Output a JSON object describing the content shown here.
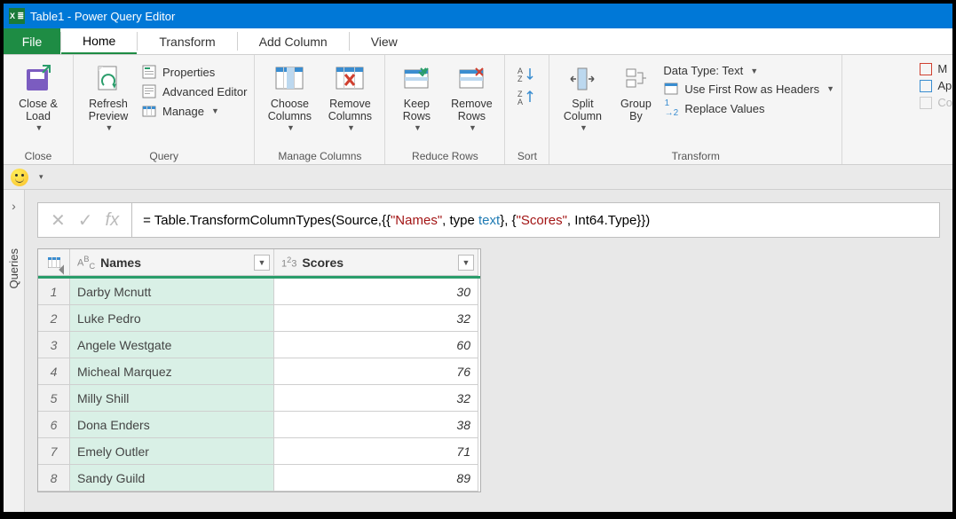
{
  "titlebar": {
    "app_icon_text": "X ≣",
    "title": "Table1 - Power Query Editor"
  },
  "tabs": {
    "file": "File",
    "items": [
      "Home",
      "Transform",
      "Add Column",
      "View"
    ],
    "active": 0
  },
  "ribbon": {
    "close": {
      "close_load": "Close &\nLoad",
      "group": "Close"
    },
    "query": {
      "refresh": "Refresh\nPreview",
      "properties": "Properties",
      "advanced": "Advanced Editor",
      "manage": "Manage",
      "group": "Query"
    },
    "managecols": {
      "choose": "Choose\nColumns",
      "remove": "Remove\nColumns",
      "group": "Manage Columns"
    },
    "reducerows": {
      "keep": "Keep\nRows",
      "remove": "Remove\nRows",
      "group": "Reduce Rows"
    },
    "sort": {
      "group": "Sort"
    },
    "splitgroup": {
      "split": "Split\nColumn",
      "groupby": "Group\nBy"
    },
    "transform": {
      "datatype": "Data Type: Text",
      "firstrow": "Use First Row as Headers",
      "replace": "Replace Values",
      "group": "Transform"
    },
    "overflow": {
      "m": "M",
      "ap": "Ap",
      "co": "Co"
    }
  },
  "queries_label": "Queries",
  "formula": {
    "prefix": "= Table.TransformColumnTypes(Source,{{",
    "s1": "\"Names\"",
    "mid1": ", type ",
    "t1": "text",
    "mid2": "}, {",
    "s2": "\"Scores\"",
    "mid3": ", Int64.Type}})"
  },
  "table": {
    "col1_type": "ABC",
    "col1_name": "Names",
    "col2_type": "1²3",
    "col2_name": "Scores",
    "rows": [
      {
        "i": "1",
        "name": "Darby Mcnutt",
        "score": "30"
      },
      {
        "i": "2",
        "name": "Luke Pedro",
        "score": "32"
      },
      {
        "i": "3",
        "name": "Angele Westgate",
        "score": "60"
      },
      {
        "i": "4",
        "name": "Micheal Marquez",
        "score": "76"
      },
      {
        "i": "5",
        "name": "Milly Shill",
        "score": "32"
      },
      {
        "i": "6",
        "name": "Dona Enders",
        "score": "38"
      },
      {
        "i": "7",
        "name": "Emely Outler",
        "score": "71"
      },
      {
        "i": "8",
        "name": "Sandy Guild",
        "score": "89"
      }
    ]
  }
}
